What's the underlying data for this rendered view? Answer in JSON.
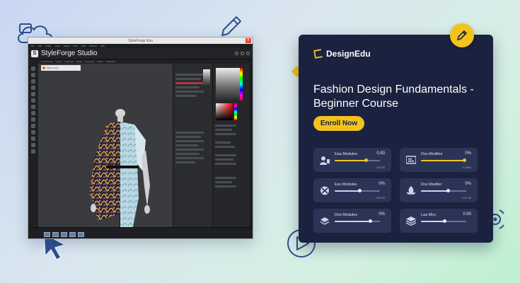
{
  "app": {
    "window_title": "StyleForge Edu",
    "brand_name": "StyleForge Studio",
    "menu_items": [
      "File",
      "Edit",
      "Image",
      "Layer",
      "Select",
      "Filter",
      "View",
      "Window",
      "Help"
    ],
    "tool_tabs": [
      "Tool Presets",
      "Layers",
      "Channels",
      "Paths",
      "Properties",
      "Adjust",
      "Swatches"
    ],
    "canvas_tab": "Fabric Layer"
  },
  "card": {
    "brand": "DesignEdu",
    "title": "Fashion Design Fundamentals - Beginner Course",
    "cta": "Enroll Now",
    "modules": [
      {
        "label": "Eaa Modules",
        "value": "0,83",
        "sub": "110.80",
        "progress": 0.68,
        "icon": "user-icon"
      },
      {
        "label": "Dos Modiles",
        "value": "0%",
        "sub": "- 0.0850",
        "progress": 0.95,
        "icon": "slides-icon"
      },
      {
        "label": "Eso Modules",
        "value": "0%",
        "sub": "3.00 90",
        "progress": 0.55,
        "icon": "tools-icon"
      },
      {
        "label": "Dos Modiler",
        "value": "0%",
        "sub": "3.20 95",
        "progress": 0.6,
        "icon": "leaf-icon"
      },
      {
        "label": "Dos Modules",
        "value": "0%",
        "sub": "",
        "progress": 0.78,
        "icon": "layers-icon"
      },
      {
        "label": "Laa Moy",
        "value": "0.50",
        "sub": "",
        "progress": 0.52,
        "icon": "stack-icon"
      }
    ]
  },
  "colors": {
    "accent": "#f2c31d",
    "card_bg": "#1b2240",
    "module_bg": "#2b3457",
    "doodle": "#2e4f8f"
  }
}
